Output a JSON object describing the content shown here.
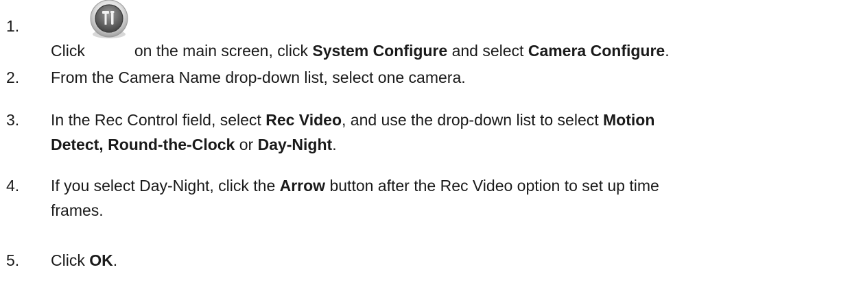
{
  "steps": [
    {
      "number": "1.",
      "parts": {
        "a": "Click",
        "b": "on the main screen, click",
        "c": "System Configure",
        "d": "and select",
        "e": "Camera Configure",
        "f": "."
      },
      "icon": "tools-settings-icon"
    },
    {
      "number": "2.",
      "parts": {
        "a": "From the Camera Name drop-down list, select one camera."
      }
    },
    {
      "number": "3.",
      "parts": {
        "a": "In the Rec Control field, select",
        "b": "Rec Video",
        "c": ", and use the drop-down list to select",
        "d": "Motion",
        "e": "Detect, Round-the-Clock",
        "f": "or",
        "g": "Day-Night",
        "h": "."
      }
    },
    {
      "number": "4.",
      "parts": {
        "a": "If you select Day-Night, click the",
        "b": "Arrow",
        "c": "button after the Rec Video option to set up time",
        "d": "frames."
      }
    },
    {
      "number": "5.",
      "parts": {
        "a": "Click",
        "b": "OK",
        "c": "."
      }
    }
  ]
}
